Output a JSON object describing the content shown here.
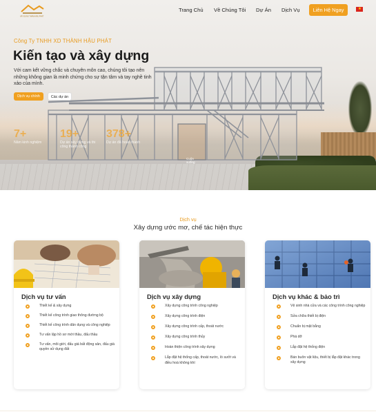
{
  "brand": {
    "logo_caption": "XÂY DỰNG THÀNH HẬU PHÁT"
  },
  "nav": {
    "items": [
      {
        "label": "Trang Chủ"
      },
      {
        "label": "Về Chúng Tôi"
      },
      {
        "label": "Dự Án"
      },
      {
        "label": "Dịch Vụ"
      }
    ],
    "contact_label": "Liên Hệ Ngay",
    "language_icon": "vietnam-flag-icon"
  },
  "hero": {
    "company": "Công Ty TNHH XD THÀNH HẬU PHÁT",
    "headline": "Kiến tạo và xây dựng",
    "description": "Với cam kết vững chắc và chuyên môn cao, chúng tôi tạo nên những không gian là minh chứng cho sự tận tâm và tay nghề tinh xảo của mình.",
    "primary_button": "Dịch vụ chính",
    "secondary_button": "Các dự án",
    "stats": [
      {
        "value": "7+",
        "label": "Năm kinh nghiệm"
      },
      {
        "value": "19+",
        "label": "Dự án xây dựng và thi công thành công"
      },
      {
        "value": "378+",
        "label": "Dự án đã hoàn thành"
      }
    ],
    "scroll_hint": "Cuộn xuống"
  },
  "services": {
    "kicker": "Dịch vụ",
    "title": "Xây dựng ước mơ, chế tác hiện thực",
    "cards": [
      {
        "title": "Dịch vụ tư vấn",
        "items": [
          "Thiết kế & xây dựng",
          "Thiết kế công trình giao thông đường bộ",
          "Thiết kế công trình dân dụng và công nghiệp",
          "Tư vấn lập hồ sơ mời thầu, đấu thầu",
          "Tư vấn, môi giới, đấu giá bất động sản, đấu giá quyền sử dụng đất"
        ]
      },
      {
        "title": "Dịch vụ xây dựng",
        "items": [
          "Xây dựng công trình công nghiệp",
          "Xây dựng công trình điện",
          "Xây dựng công trình cấp, thoát nước",
          "Xây dựng công trình thủy",
          "Hoàn thiện công trình xây dựng",
          "Lắp đặt hệ thống cấp, thoát nước, lò sưởi và điều hoà không khí"
        ]
      },
      {
        "title": "Dịch vụ khác & bảo trì",
        "items": [
          "Vệ sinh nhà cửa và các công trình công nghiệp",
          "Sửa chữa thiết bị điện",
          "Chuẩn bị mặt bằng",
          "Phá dỡ",
          "Lắp đặt hệ thống điện",
          "Bán buôn vật liệu, thiết bị lắp đặt khác trong xây dựng"
        ]
      }
    ]
  },
  "colors": {
    "accent": "#f0a020",
    "kicker": "#e89a1d"
  }
}
